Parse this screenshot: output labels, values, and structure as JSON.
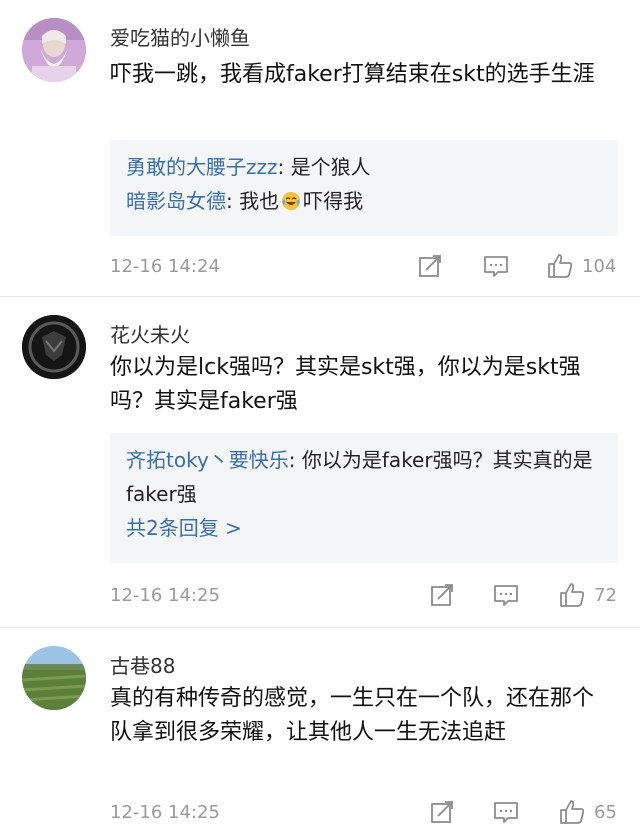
{
  "comments": [
    {
      "username": "爱吃猫的小懒鱼",
      "text": "吓我一跳，我看成faker打算结束在skt的选手生涯",
      "replies": [
        {
          "name": "勇敢的大腰子zzz",
          "text": ": 是个狼人"
        },
        {
          "name": "暗影岛女德",
          "text_before": ": 我也",
          "text_after": "吓得我",
          "emoji": "laughing-crying-emoji"
        }
      ],
      "time": "12-16 14:24",
      "likes": "104"
    },
    {
      "username": "花火未火",
      "text": "你以为是lck强吗？其实是skt强，你以为是skt强吗？其实是faker强",
      "replies": [
        {
          "name": "齐拓toky丶要快乐",
          "text": ": 你以为是faker强吗？其实真的是faker强"
        }
      ],
      "more_replies": "共2条回复 >",
      "time": "12-16 14:25",
      "likes": "72"
    },
    {
      "username": "古巷88",
      "text": "真的有种传奇的感觉，一生只在一个队，还在那个队拿到很多荣耀，让其他人一生无法追赶",
      "time": "12-16 14:25",
      "likes": "65"
    }
  ],
  "icons": {
    "share": "share-icon",
    "comment": "comment-icon",
    "like": "thumbs-up-icon"
  },
  "colors": {
    "reply_name": "#3b6ea8",
    "reply_bg": "#f4f5f7",
    "meta_gray": "#9a9a9a"
  }
}
